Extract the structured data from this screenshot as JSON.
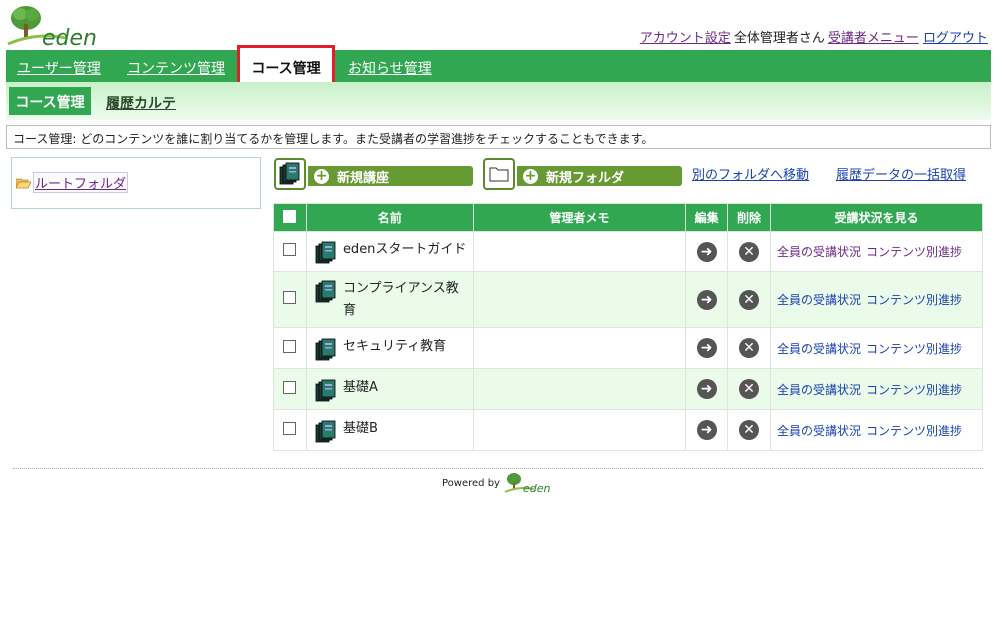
{
  "header": {
    "logo_text": "eden",
    "links": {
      "account_settings": "アカウント設定",
      "user_name": "全体管理者さん",
      "learner_menu": "受講者メニュー",
      "logout": "ログアウト"
    }
  },
  "main_nav": {
    "items": [
      "ユーザー管理",
      "コンテンツ管理",
      "コース管理",
      "お知らせ管理"
    ],
    "active": "コース管理"
  },
  "sub_nav": {
    "items": [
      "コース管理",
      "履歴カルテ"
    ],
    "active": "コース管理"
  },
  "description": "コース管理: どのコンテンツを誰に割り当てるかを管理します。また受講者の学習進捗をチェックすることもできます。",
  "tree": {
    "root_label": "ルートフォルダ"
  },
  "toolbar": {
    "new_course": "新規講座",
    "new_folder": "新規フォルダ",
    "move_folder": "別のフォルダへ移動",
    "bulk_history": "履歴データの一括取得"
  },
  "table": {
    "headers": {
      "name": "名前",
      "memo": "管理者メモ",
      "edit": "編集",
      "delete": "削除",
      "status": "受講状況を見る"
    },
    "rows": [
      {
        "name": "edenスタートガイド",
        "memo": "",
        "all_status": "全員の受講状況",
        "by_content": "コンテンツ別進捗"
      },
      {
        "name": "コンプライアンス教育",
        "memo": "",
        "all_status": "全員の受講状況",
        "by_content": "コンテンツ別進捗"
      },
      {
        "name": "セキュリティ教育",
        "memo": "",
        "all_status": "全員の受講状況",
        "by_content": "コンテンツ別進捗"
      },
      {
        "name": "基礎A",
        "memo": "",
        "all_status": "全員の受講状況",
        "by_content": "コンテンツ別進捗"
      },
      {
        "name": "基礎B",
        "memo": "",
        "all_status": "全員の受講状況",
        "by_content": "コンテンツ別進捗"
      }
    ]
  },
  "footer": {
    "powered_by": "Powered by",
    "logo_text": "eden"
  },
  "colors": {
    "brand_green": "#31a752",
    "button_green": "#689a33",
    "highlight_red": "#e0202a"
  }
}
